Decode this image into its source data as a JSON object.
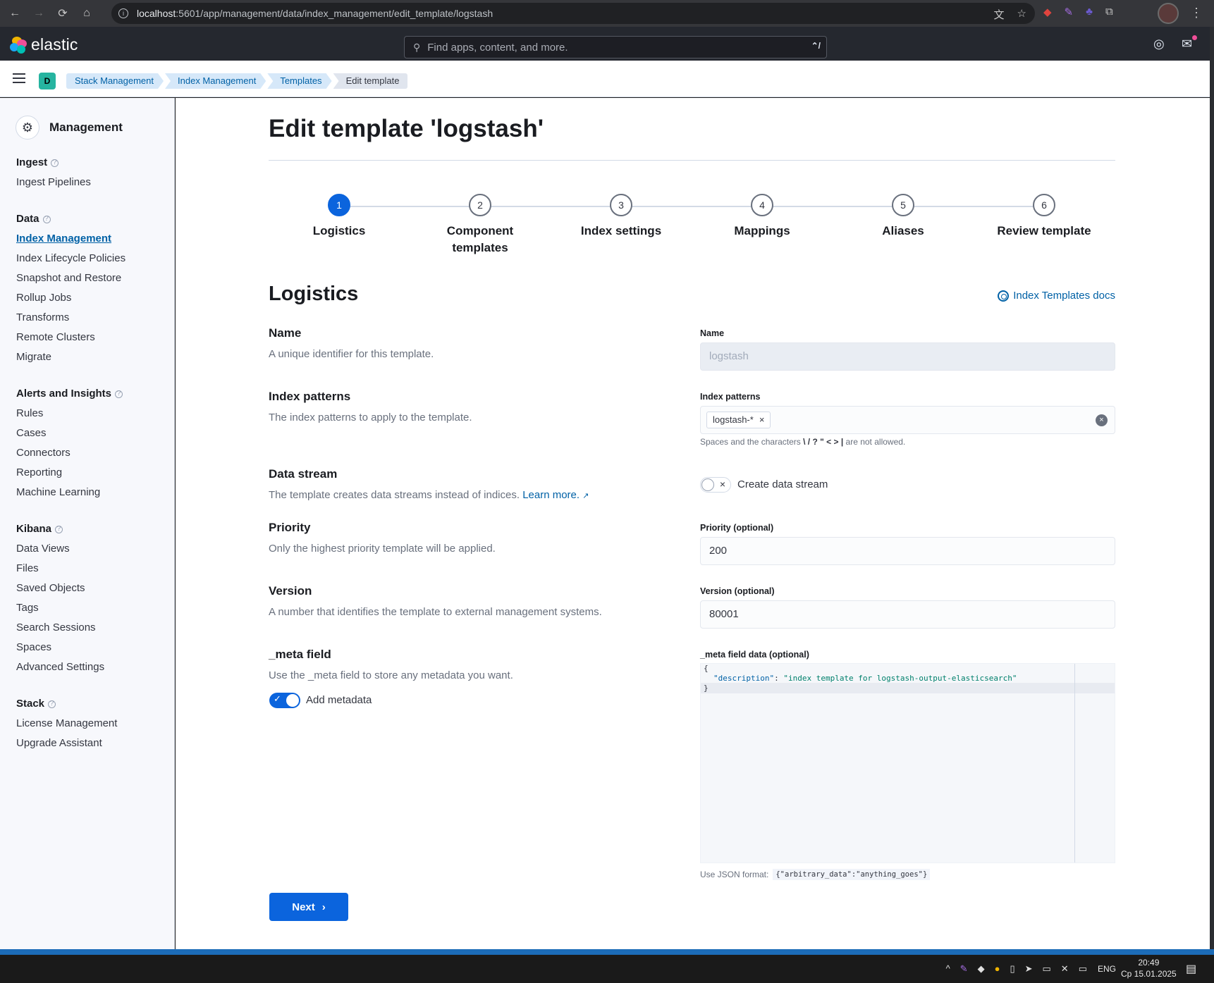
{
  "browser": {
    "url_host": "localhost",
    "url_path": ":5601/app/management/data/index_management/edit_template/logstash"
  },
  "header": {
    "brand": "elastic",
    "search_placeholder": "Find apps, content, and more.",
    "search_shortcut": "⌃/"
  },
  "breadcrumbs": {
    "space_initial": "D",
    "items": [
      "Stack Management",
      "Index Management",
      "Templates",
      "Edit template"
    ]
  },
  "sidebar": {
    "title": "Management",
    "groups": [
      {
        "title": "Ingest",
        "items": [
          "Ingest Pipelines"
        ]
      },
      {
        "title": "Data",
        "items": [
          "Index Management",
          "Index Lifecycle Policies",
          "Snapshot and Restore",
          "Rollup Jobs",
          "Transforms",
          "Remote Clusters",
          "Migrate"
        ]
      },
      {
        "title": "Alerts and Insights",
        "items": [
          "Rules",
          "Cases",
          "Connectors",
          "Reporting",
          "Machine Learning"
        ]
      },
      {
        "title": "Kibana",
        "items": [
          "Data Views",
          "Files",
          "Saved Objects",
          "Tags",
          "Search Sessions",
          "Spaces",
          "Advanced Settings"
        ]
      },
      {
        "title": "Stack",
        "items": [
          "License Management",
          "Upgrade Assistant"
        ]
      }
    ],
    "active_item": "Index Management"
  },
  "page": {
    "title": "Edit template 'logstash'",
    "steps": [
      {
        "num": "1",
        "label": "Logistics"
      },
      {
        "num": "2",
        "label": "Component templates"
      },
      {
        "num": "3",
        "label": "Index settings"
      },
      {
        "num": "4",
        "label": "Mappings"
      },
      {
        "num": "5",
        "label": "Aliases"
      },
      {
        "num": "6",
        "label": "Review template"
      }
    ],
    "current_step": 1,
    "section_title": "Logistics",
    "docs_link": "Index Templates docs"
  },
  "form": {
    "name": {
      "title": "Name",
      "desc": "A unique identifier for this template.",
      "label": "Name",
      "value": "logstash"
    },
    "index_patterns": {
      "title": "Index patterns",
      "desc": "The index patterns to apply to the template.",
      "label": "Index patterns",
      "chip": "logstash-*",
      "help_prefix": "Spaces and the characters",
      "help_chars": "\\ / ? \" < > |",
      "help_suffix": "are not allowed."
    },
    "data_stream": {
      "title": "Data stream",
      "desc": "The template creates data streams instead of indices.",
      "learn_more": "Learn more.",
      "toggle_label": "Create data stream",
      "enabled": false
    },
    "priority": {
      "title": "Priority",
      "desc": "Only the highest priority template will be applied.",
      "label": "Priority (optional)",
      "value": "200"
    },
    "version": {
      "title": "Version",
      "desc": "A number that identifies the template to external management systems.",
      "label": "Version (optional)",
      "value": "80001"
    },
    "meta": {
      "title": "_meta field",
      "desc": "Use the _meta field to store any metadata you want.",
      "toggle_label": "Add metadata",
      "enabled": true,
      "label": "_meta field data (optional)",
      "code_open": "{",
      "code_key": "\"description\"",
      "code_value": "\"index template for logstash-output-elasticsearch\"",
      "code_close": "}",
      "json_help": "Use JSON format:",
      "json_example": "{\"arbitrary_data\":\"anything_goes\"}"
    }
  },
  "actions": {
    "next": "Next"
  },
  "taskbar": {
    "lang": "ENG",
    "time": "20:49",
    "date": "Ср 15.01.2025"
  },
  "colors": {
    "primary": "#0b64dd",
    "link": "#0061a6",
    "header_bg": "#25282f"
  }
}
